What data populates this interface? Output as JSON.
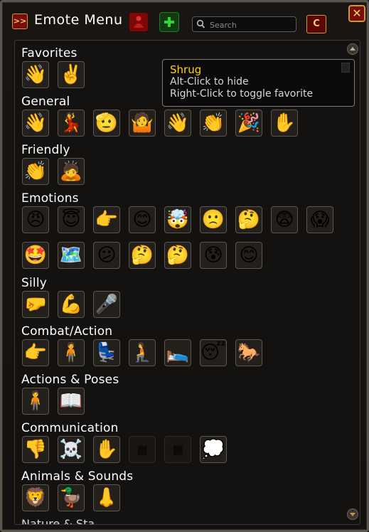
{
  "window": {
    "title": "Emote Menu",
    "menu_glyph": ">>",
    "c_button_label": "C",
    "close_glyph": "✕"
  },
  "search": {
    "placeholder": "Search",
    "value": ""
  },
  "tooltip": {
    "title": "Shrug",
    "lines": [
      "Alt-Click to hide",
      "Right-Click to toggle favorite"
    ]
  },
  "sections": [
    {
      "title": "Favorites",
      "emotes": [
        {
          "icon": "waving-hand-emoji",
          "glyph": "👋"
        },
        {
          "icon": "victory-hand-emoji",
          "glyph": "✌️"
        }
      ]
    },
    {
      "title": "General",
      "emotes": [
        {
          "icon": "waving-hand-emoji",
          "glyph": "👋"
        },
        {
          "icon": "woman-dancing-emoji",
          "glyph": "💃"
        },
        {
          "icon": "saluting-face-emoji",
          "glyph": "🫡"
        },
        {
          "icon": "person-shrugging-emoji",
          "glyph": "🤷"
        },
        {
          "icon": "waving-hand-emoji",
          "glyph": "👋"
        },
        {
          "icon": "clapping-hands-emoji",
          "glyph": "👏"
        },
        {
          "icon": "party-popper-emoji",
          "glyph": "🎉"
        },
        {
          "icon": "raised-hand-emoji",
          "glyph": "✋"
        }
      ]
    },
    {
      "title": "Friendly",
      "emotes": [
        {
          "icon": "clapping-hands-emoji",
          "glyph": "👏"
        },
        {
          "icon": "bowing-emoji",
          "glyph": "🙇"
        }
      ]
    },
    {
      "title": "Emotions",
      "emotes": [
        {
          "icon": "angry-face-emoji",
          "glyph": "😠"
        },
        {
          "icon": "halo-face-emoji",
          "glyph": "😇"
        },
        {
          "icon": "pointing-hand-emoji",
          "glyph": "👉"
        },
        {
          "icon": "smiling-face-emoji",
          "glyph": "😊"
        },
        {
          "icon": "exploding-head-emoji",
          "glyph": "🤯"
        },
        {
          "icon": "frowning-face-emoji",
          "glyph": "🙁"
        },
        {
          "icon": "thinking-face-emoji",
          "glyph": "🤔"
        },
        {
          "icon": "fearful-face-emoji",
          "glyph": "😨"
        },
        {
          "icon": "screaming-face-emoji",
          "glyph": "😱"
        },
        {
          "icon": "star-struck-emoji",
          "glyph": "🤩"
        },
        {
          "icon": "world-map-emoji",
          "glyph": "🗺️"
        },
        {
          "icon": "confused-face-emoji",
          "glyph": "😕"
        },
        {
          "icon": "thinking-face-emoji",
          "glyph": "🤔"
        },
        {
          "icon": "thinking-face-emoji",
          "glyph": "🤔"
        },
        {
          "icon": "cold-sweat-face-emoji",
          "glyph": "😰"
        },
        {
          "icon": "blushing-face-emoji",
          "glyph": "😊"
        }
      ]
    },
    {
      "title": "Silly",
      "emotes": [
        {
          "icon": "fist-emoji",
          "glyph": "🤛"
        },
        {
          "icon": "flexed-biceps-emoji",
          "glyph": "💪"
        },
        {
          "icon": "microphone-emoji",
          "glyph": "🎤"
        }
      ]
    },
    {
      "title": "Combat/Action",
      "emotes": [
        {
          "icon": "pointing-hand-emoji",
          "glyph": "👉"
        },
        {
          "icon": "person-standing-emoji",
          "glyph": "🧍"
        },
        {
          "icon": "seat-emoji",
          "glyph": "💺"
        },
        {
          "icon": "person-kneeling-emoji",
          "glyph": "🧎"
        },
        {
          "icon": "bed-emoji",
          "glyph": "🛌"
        },
        {
          "icon": "sleeping-face-emoji",
          "glyph": "😴"
        },
        {
          "icon": "horse-emoji",
          "glyph": "🐎"
        }
      ]
    },
    {
      "title": "Actions & Poses",
      "emotes": [
        {
          "icon": "person-standing-emoji",
          "glyph": "🧍"
        },
        {
          "icon": "open-book-emoji",
          "glyph": "📖"
        }
      ]
    },
    {
      "title": "Communication",
      "emotes": [
        {
          "icon": "thumbs-down-emoji",
          "glyph": "👎"
        },
        {
          "icon": "skull-crossbones-emoji",
          "glyph": "☠️"
        },
        {
          "icon": "raised-hand-emoji",
          "glyph": "✋"
        },
        {
          "icon": "dark-placeholder-icon",
          "glyph": "▪",
          "dim": true
        },
        {
          "icon": "dark-placeholder-icon",
          "glyph": "▪",
          "dim": true
        },
        {
          "icon": "thought-balloon-emoji",
          "glyph": "💭"
        }
      ]
    },
    {
      "title": "Animals & Sounds",
      "emotes": [
        {
          "icon": "lion-emoji",
          "glyph": "🦁"
        },
        {
          "icon": "duck-emoji",
          "glyph": "🦆"
        },
        {
          "icon": "nose-emoji",
          "glyph": "👃"
        }
      ]
    }
  ],
  "cutoff_text": "Nature & Sta",
  "colors": {
    "title_text": "#ffffff",
    "tooltip_title": "#ffd200",
    "accent_gold": "#c79a3a",
    "button_red": "#7a0d0d"
  }
}
